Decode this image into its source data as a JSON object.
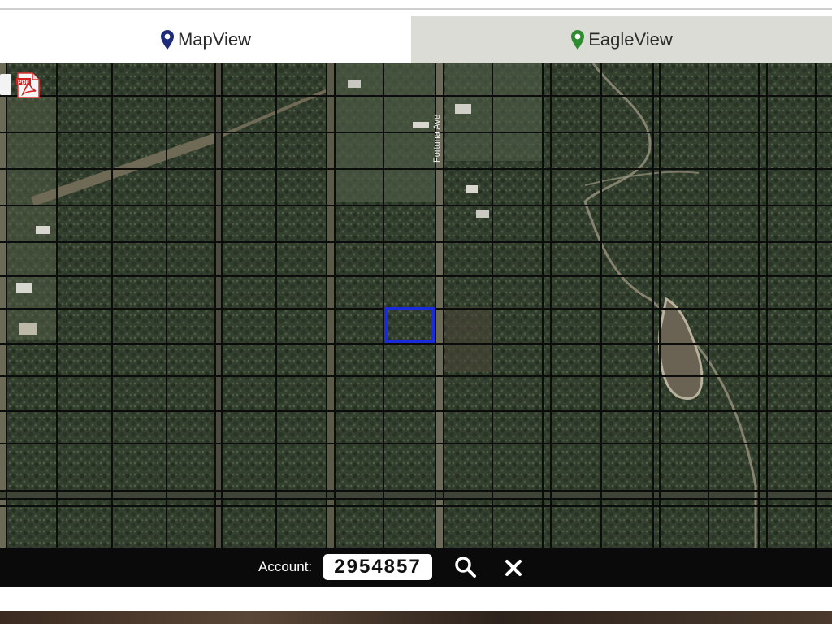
{
  "tabs": [
    {
      "label": "MapView",
      "icon": "map-pin-icon",
      "color": "#1e2a7a"
    },
    {
      "label": "EagleView",
      "icon": "map-pin-icon",
      "color": "#2e8b2e"
    }
  ],
  "toolbar": {
    "pdf_icon": "pdf-icon"
  },
  "map": {
    "street_label": "Fortuna Ave",
    "parcel_highlight_color": "#1a2bdc"
  },
  "account_bar": {
    "label": "Account:",
    "value": "2954857",
    "search_icon": "search-icon",
    "close_icon": "close-icon"
  }
}
